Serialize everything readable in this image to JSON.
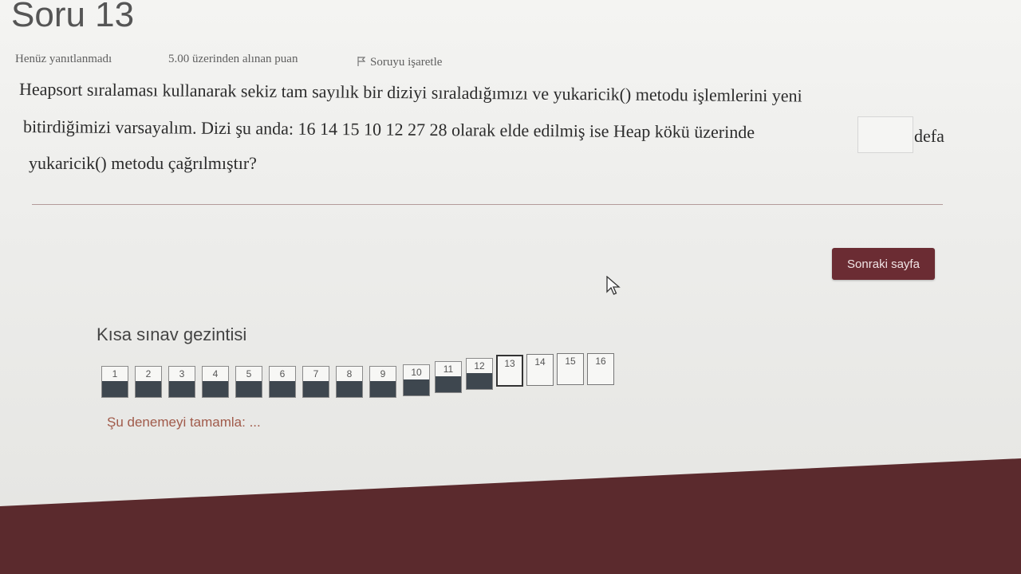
{
  "question": {
    "title": "Soru 13",
    "status": "Henüz yanıtlanmadı",
    "points": "5.00 üzerinden alınan puan",
    "flag_label": "Soruyu işaretle",
    "text_line1": "Heapsort sıralaması kullanarak sekiz tam sayılık bir diziyi sıraladığımızı ve yukaricik() metodu işlemlerini yeni",
    "text_line2": "bitirdiğimizi varsayalım. Dizi şu anda: 16 14 15 10 12 27 28 olarak elde edilmiş ise Heap kökü üzerinde",
    "text_after_blank": "defa",
    "text_line3": "yukaricik() metodu çağrılmıştır?",
    "answer_value": ""
  },
  "next_button": {
    "label": "Sonraki sayfa"
  },
  "quiz_nav": {
    "title": "Kısa sınav gezintisi",
    "buttons": [
      {
        "label": "1",
        "state": "answered"
      },
      {
        "label": "2",
        "state": "answered"
      },
      {
        "label": "3",
        "state": "answered"
      },
      {
        "label": "4",
        "state": "answered"
      },
      {
        "label": "5",
        "state": "answered"
      },
      {
        "label": "6",
        "state": "answered"
      },
      {
        "label": "7",
        "state": "answered"
      },
      {
        "label": "8",
        "state": "answered"
      },
      {
        "label": "9",
        "state": "answered"
      },
      {
        "label": "10",
        "state": "answered"
      },
      {
        "label": "11",
        "state": "answered"
      },
      {
        "label": "12",
        "state": "answered"
      },
      {
        "label": "13",
        "state": "current"
      },
      {
        "label": "14",
        "state": "unanswered"
      },
      {
        "label": "15",
        "state": "unanswered"
      },
      {
        "label": "16",
        "state": "unanswered"
      }
    ],
    "finish_link": "Şu denemeyi tamamla: ..."
  },
  "colors": {
    "accent": "#6b2c33",
    "answered_fill": "#3e474f",
    "footer": "#5b2a2d"
  },
  "icons": {
    "flag": "flag-icon",
    "cursor": "mouse-cursor-icon"
  }
}
